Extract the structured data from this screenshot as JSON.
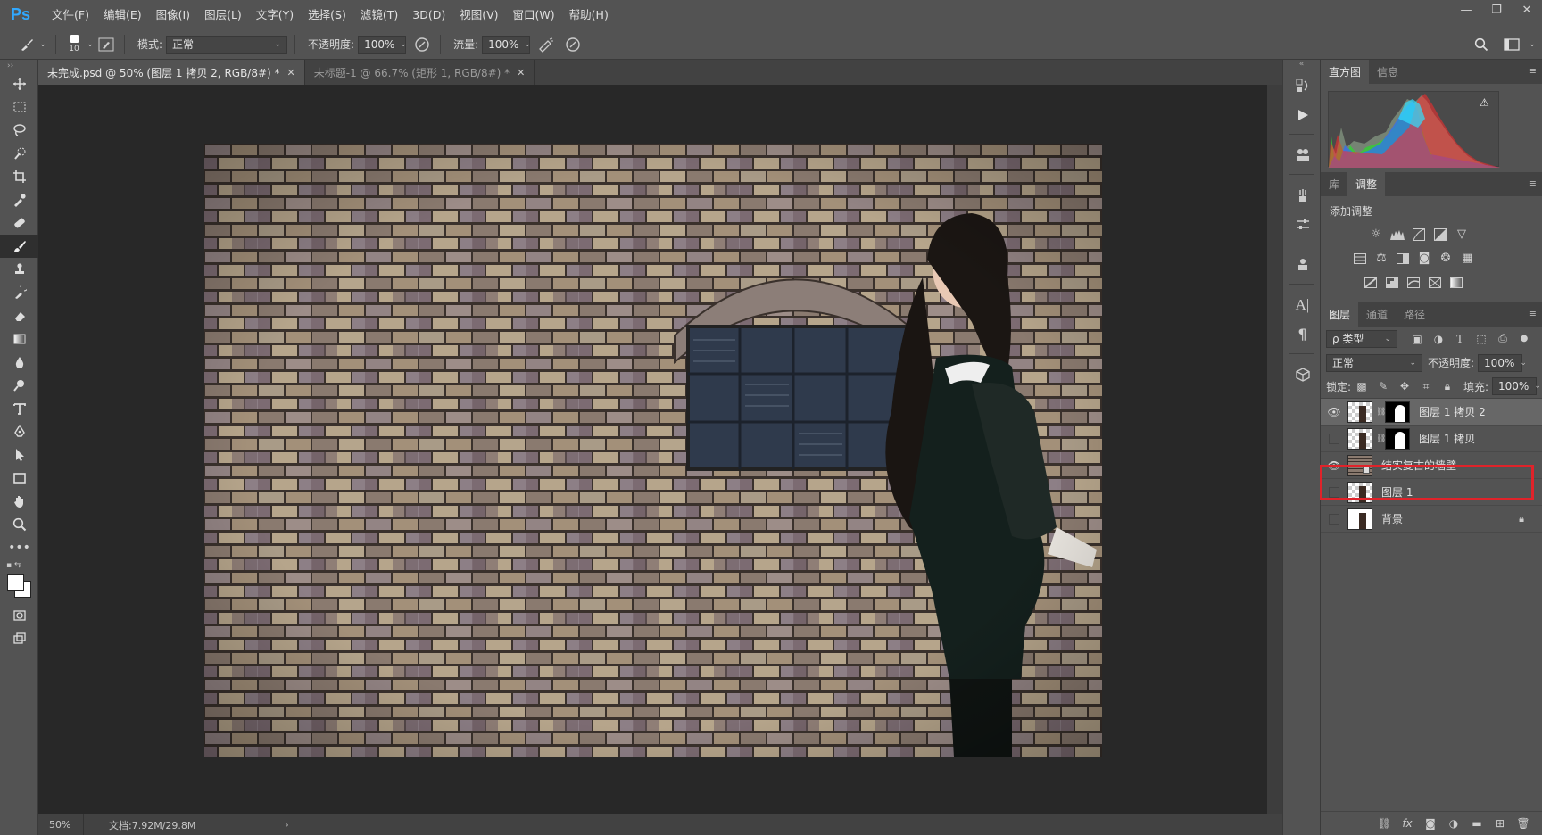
{
  "app": {
    "logo": "Ps"
  },
  "menu": [
    "文件(F)",
    "编辑(E)",
    "图像(I)",
    "图层(L)",
    "文字(Y)",
    "选择(S)",
    "滤镜(T)",
    "3D(D)",
    "视图(V)",
    "窗口(W)",
    "帮助(H)"
  ],
  "window_controls": {
    "minimize": "—",
    "restore": "❐",
    "close": "✕"
  },
  "options": {
    "brush_size": "10",
    "mode_label": "模式:",
    "mode_value": "正常",
    "opacity_label": "不透明度:",
    "opacity_value": "100%",
    "flow_label": "流量:",
    "flow_value": "100%"
  },
  "tabs": [
    {
      "label": "未完成.psd @ 50% (图层 1 拷贝 2, RGB/8#) *",
      "active": true
    },
    {
      "label": "未标题-1 @ 66.7% (矩形 1, RGB/8#) *",
      "active": false
    }
  ],
  "status": {
    "zoom": "50%",
    "doc": "文档:7.92M/29.8M",
    "arrow": "›"
  },
  "panels": {
    "histogram_tabs": [
      "直方图",
      "信息"
    ],
    "adjust_tabs": [
      "库",
      "调整"
    ],
    "adjust_title": "添加调整",
    "layer_tabs": [
      "图层",
      "通道",
      "路径"
    ],
    "filter_label": "ρ 类型",
    "blend_mode": "正常",
    "opacity_label": "不透明度:",
    "opacity_value": "100%",
    "lock_label": "锁定:",
    "fill_label": "填充:",
    "fill_value": "100%"
  },
  "layers": [
    {
      "name": "图层 1 拷贝 2",
      "visible": true,
      "selected": true,
      "mask": true
    },
    {
      "name": "图层 1 拷贝",
      "visible": false,
      "selected": false,
      "mask": true
    },
    {
      "name": "结实复古的墙壁",
      "visible": true,
      "selected": false,
      "mask": false,
      "highlighted": true
    },
    {
      "name": "图层 1",
      "visible": false,
      "selected": false,
      "mask": false
    },
    {
      "name": "背景",
      "visible": false,
      "selected": false,
      "mask": false,
      "locked": true
    }
  ],
  "colors": {
    "accent": "#31a8ff",
    "highlight_box": "#e0232a"
  }
}
